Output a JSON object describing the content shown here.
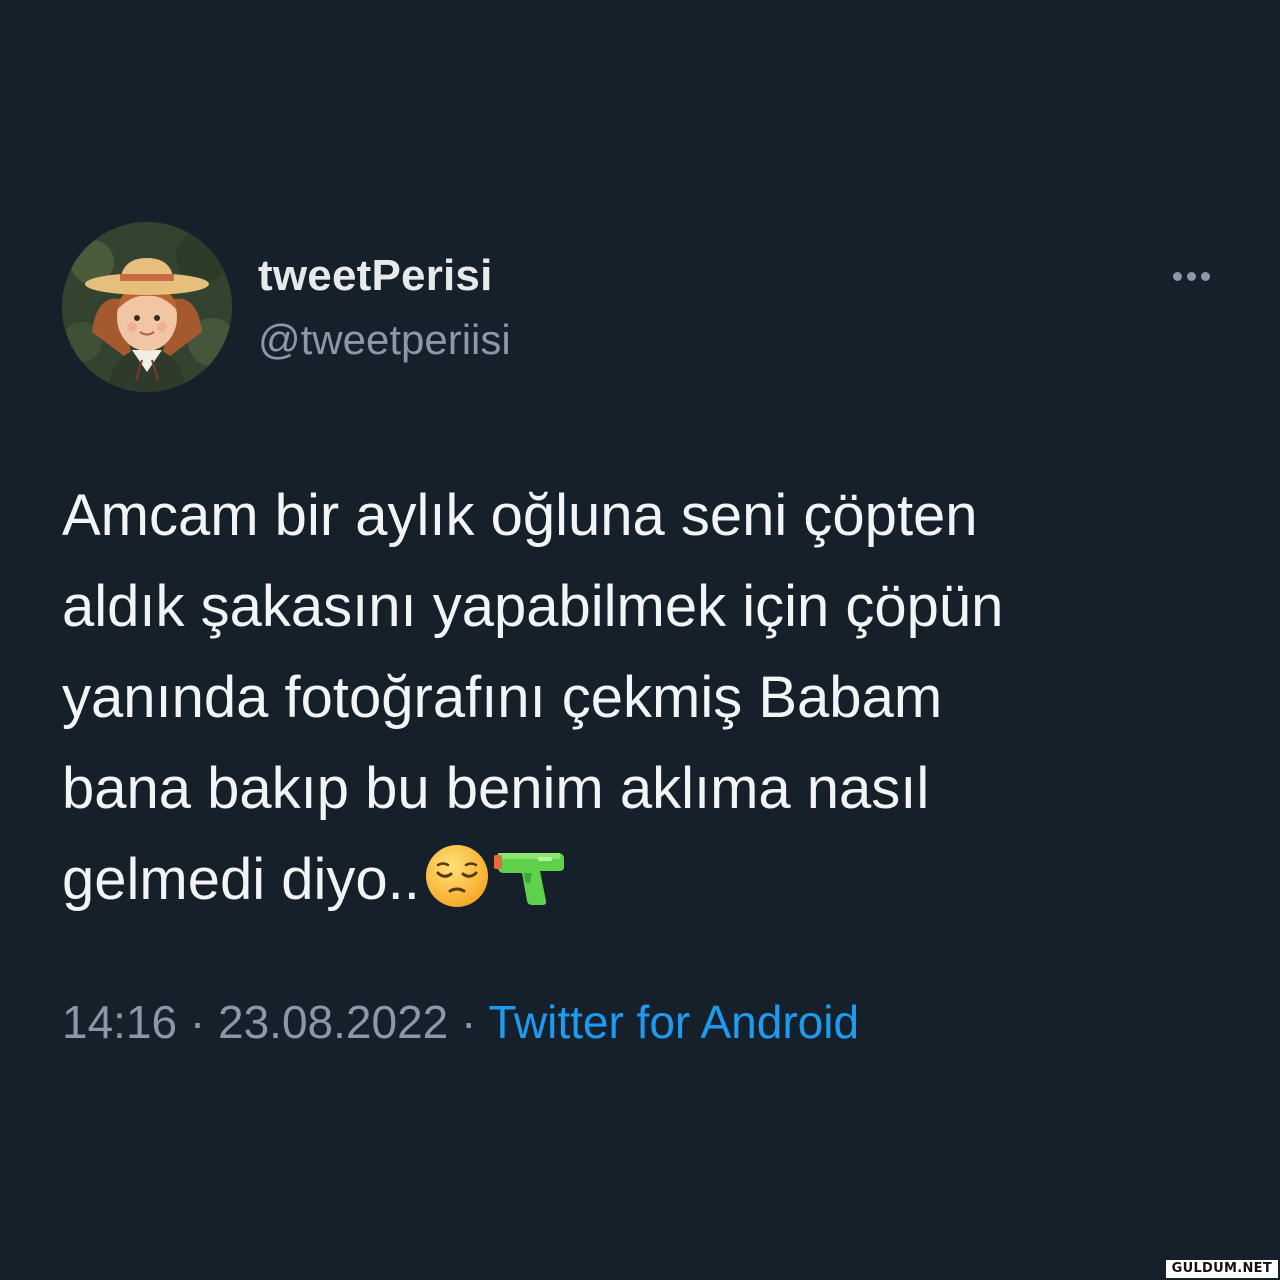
{
  "tweet": {
    "display_name": "tweetPerisi",
    "handle": "@tweetperiisi",
    "text_lines": [
      "Amcam bir aylık oğluna seni çöpten",
      "aldık şakasını yapabilmek için çöpün",
      "yanında fotoğrafını çekmiş Babam",
      "bana bakıp bu benim aklıma nasıl",
      "gelmedi diyo.."
    ],
    "emojis": [
      "pensive-face-icon",
      "water-pistol-icon"
    ],
    "time": "14:16",
    "separator": "·",
    "date": "23.08.2022",
    "source": "Twitter for Android"
  },
  "watermark": "GULDUM.NET",
  "colors": {
    "background": "#15202b",
    "text": "#e7e9ea",
    "secondary": "#8b98a5",
    "link": "#1d9bf0"
  }
}
